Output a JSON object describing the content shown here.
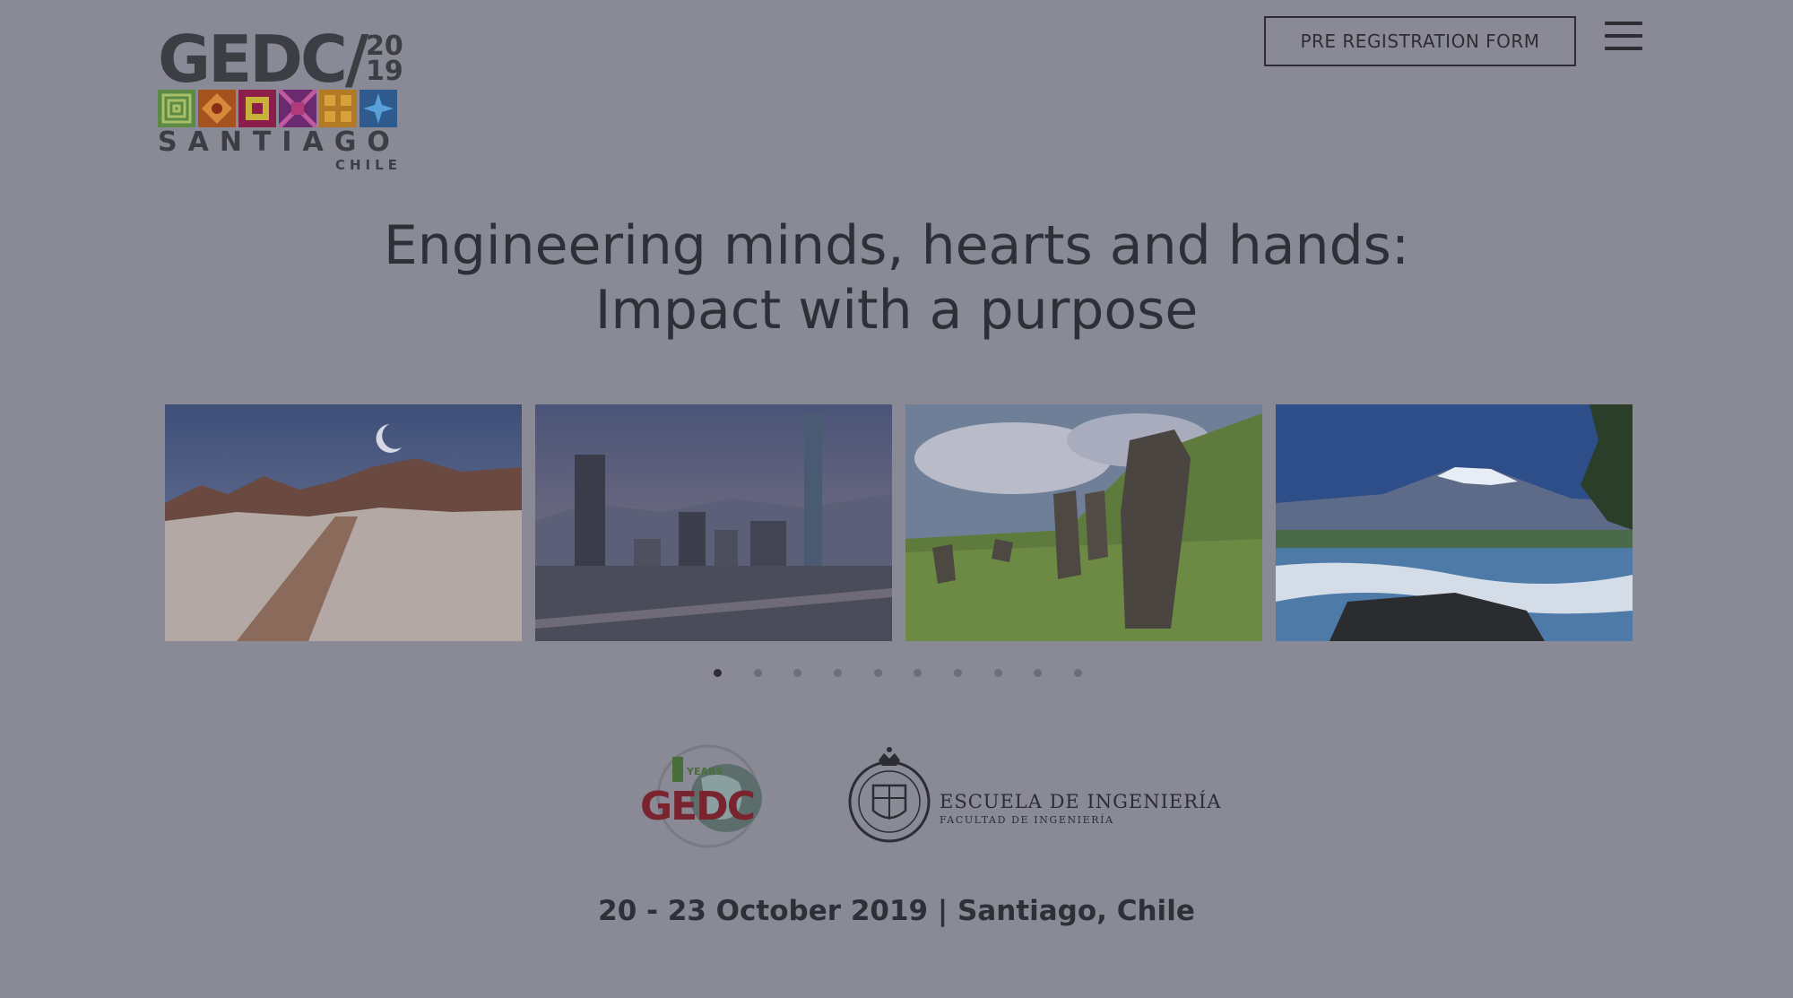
{
  "header": {
    "logo": {
      "main_text": "GEDC/",
      "year_top": "20",
      "year_bottom": "19",
      "city": "SANTIAGO",
      "country": "CHILE",
      "tile_colors": [
        "#6aa84f",
        "#e06c2a",
        "#c2185b",
        "#8e24aa",
        "#f2a21e",
        "#2a78c8"
      ]
    },
    "prereg_label": "PRE REGISTRATION FORM",
    "menu_icon": "hamburger-menu-icon"
  },
  "hero": {
    "title_line1": "Engineering minds, hearts and hands:",
    "title_line2": "Impact with a purpose"
  },
  "carousel": {
    "slides": [
      {
        "subject": "Atacama desert road with moon"
      },
      {
        "subject": "Santiago skyline with tower"
      },
      {
        "subject": "Easter Island moai statues"
      },
      {
        "subject": "Volcano with waterfalls"
      }
    ],
    "dot_count": 10,
    "active_index": 0
  },
  "partners": {
    "gedc": {
      "text": "GEDC",
      "badge": "YEARS"
    },
    "escuela": {
      "name": "ESCUELA DE INGENIERÍA",
      "faculty": "FACULTAD DE INGENIERÍA"
    }
  },
  "event": {
    "date_location": "20 - 23 October 2019 | Santiago, Chile"
  },
  "colors": {
    "overlay_bg": "#8a8a97",
    "text": "#2e2e35"
  }
}
